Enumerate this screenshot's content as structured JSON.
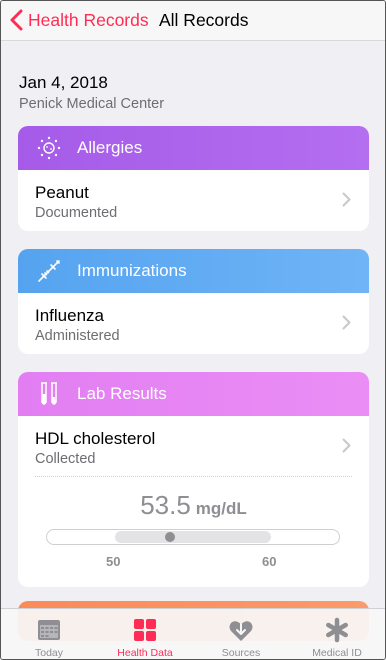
{
  "nav": {
    "back_label": "Health Records",
    "title": "All Records"
  },
  "header": {
    "date": "Jan 4, 2018",
    "provider": "Penick Medical Center"
  },
  "cards": {
    "allergies": {
      "category": "Allergies",
      "icon": "allergy-pollen-icon",
      "item_title": "Peanut",
      "item_subtitle": "Documented"
    },
    "immunizations": {
      "category": "Immunizations",
      "icon": "syringe-icon",
      "item_title": "Influenza",
      "item_subtitle": "Administered"
    },
    "lab_results": {
      "category": "Lab Results",
      "icon": "test-tubes-icon",
      "item_title": "HDL cholesterol",
      "item_subtitle": "Collected",
      "value": "53.5",
      "unit": "mg/dL",
      "range_low": "50",
      "range_high": "60",
      "value_fraction_of_range": 0.35
    }
  },
  "tabs": [
    {
      "label": "Today",
      "icon": "calendar-icon",
      "active": false
    },
    {
      "label": "Health Data",
      "icon": "grid-icon",
      "active": true
    },
    {
      "label": "Sources",
      "icon": "heart-download-icon",
      "active": false
    },
    {
      "label": "Medical ID",
      "icon": "asterisk-icon",
      "active": false
    }
  ],
  "colors": {
    "accent": "#ff2d55",
    "allergies": "#a55be8",
    "immunizations": "#55a3f0",
    "lab_results": "#e27ef2",
    "next_card": "#f98b58"
  }
}
